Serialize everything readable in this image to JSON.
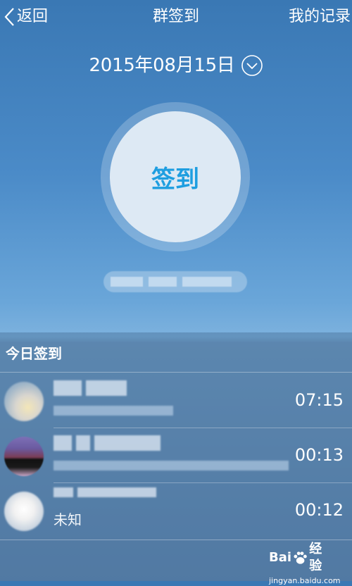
{
  "header": {
    "back_label": "返回",
    "title": "群签到",
    "records_label": "我的记录"
  },
  "date": {
    "text": "2015年08月15日"
  },
  "checkin": {
    "label": "签到"
  },
  "today": {
    "title": "今日签到"
  },
  "list": [
    {
      "time": "07:15"
    },
    {
      "time": "00:13"
    },
    {
      "time": "00:12",
      "subtitle": "未知"
    }
  ],
  "watermark": {
    "brand": "Bai",
    "brand2": "经验",
    "url": "jingyan.baidu.com"
  },
  "colors": {
    "accent": "#1e9ee0",
    "text": "#ffffff"
  }
}
